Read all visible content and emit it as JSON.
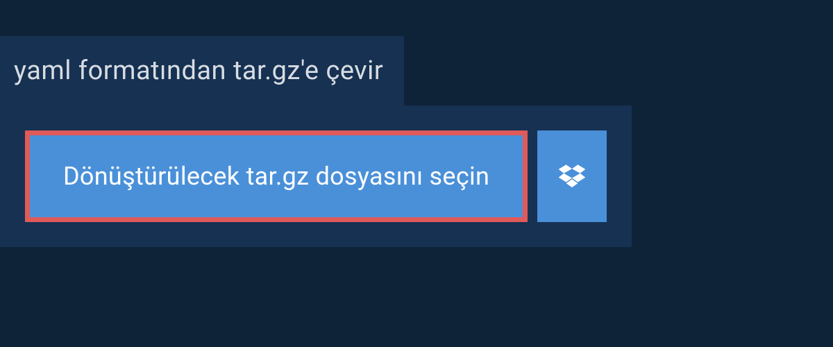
{
  "header": {
    "title": "yaml formatından tar.gz'e çevir"
  },
  "actions": {
    "select_file_label": "Dönüştürülecek tar.gz dosyasını seçin",
    "dropbox_icon": "dropbox"
  },
  "colors": {
    "background": "#0f2338",
    "panel": "#163152",
    "button_primary": "#4a90d9",
    "button_highlight_border": "#e05a5a",
    "text_light": "#d8dde3",
    "text_white": "#ffffff"
  }
}
